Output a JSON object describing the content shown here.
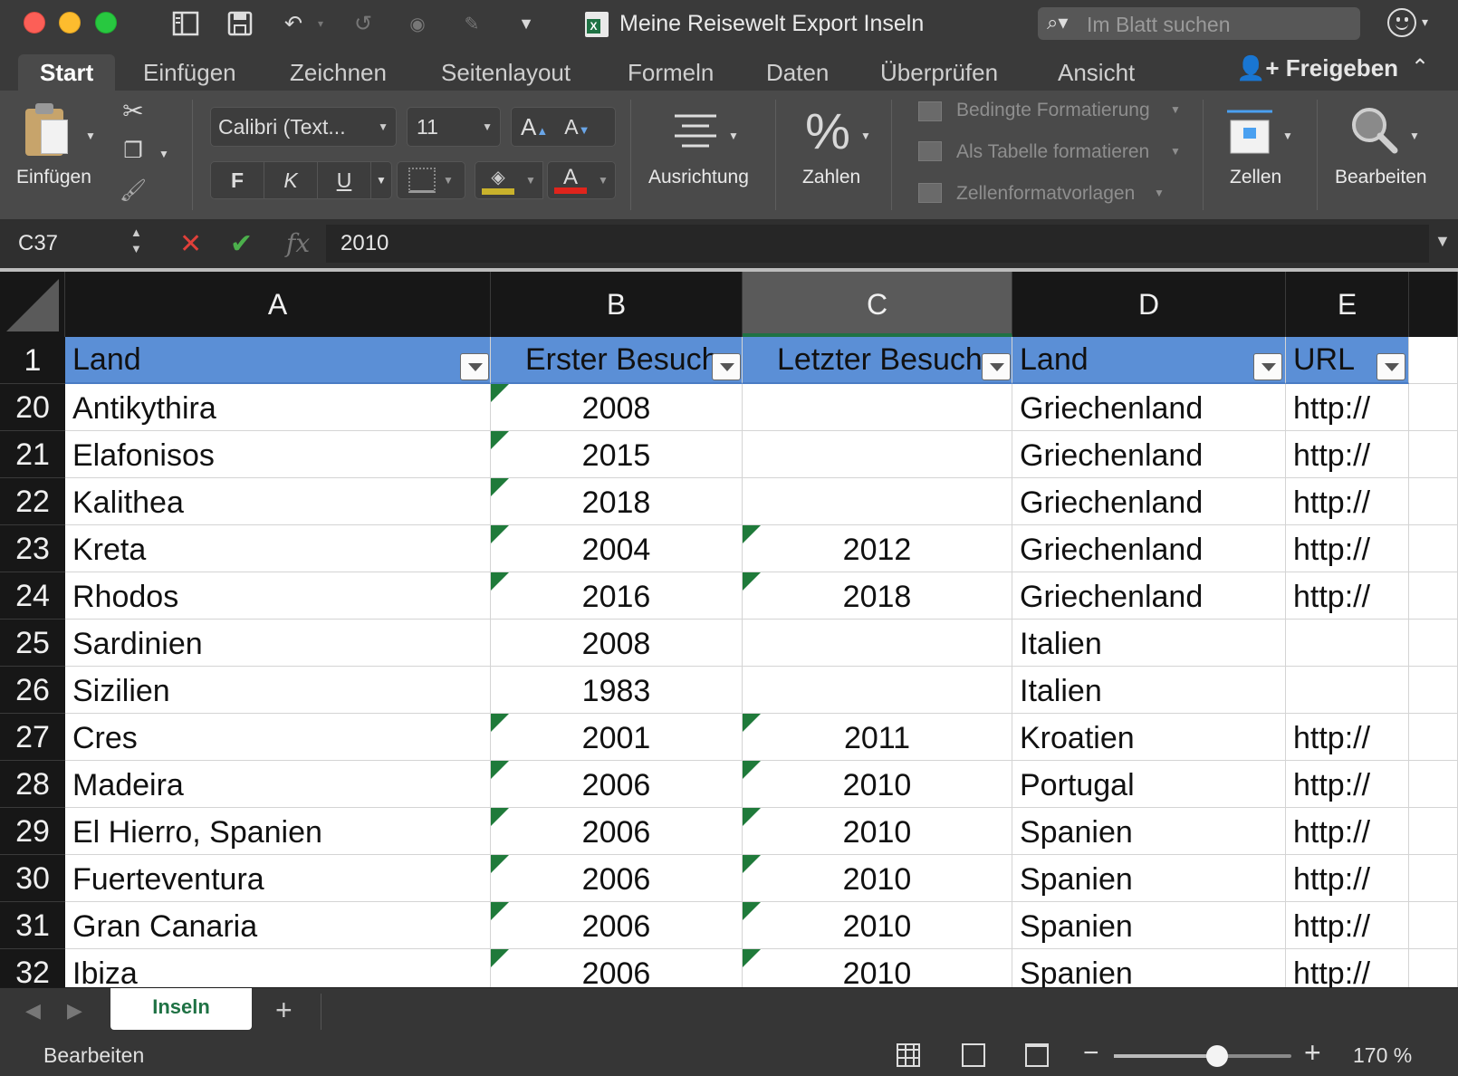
{
  "window": {
    "title": "Meine Reisewelt Export Inseln",
    "search_placeholder": "Im Blatt suchen"
  },
  "ribbon_tabs": [
    "Start",
    "Einfügen",
    "Zeichnen",
    "Seitenlayout",
    "Formeln",
    "Daten",
    "Überprüfen",
    "Ansicht"
  ],
  "share_label": "Freigeben",
  "ribbon": {
    "paste_label": "Einfügen",
    "font_name": "Calibri (Text...",
    "font_size": "11",
    "grow_font": "A",
    "shrink_font": "A",
    "bold": "F",
    "italic": "K",
    "underline": "U",
    "font_color_letter": "A",
    "alignment_label": "Ausrichtung",
    "number_label": "Zahlen",
    "number_symbol": "%",
    "conditional_formatting": "Bedingte Formatierung",
    "format_as_table": "Als Tabelle formatieren",
    "cell_styles": "Zellenformatvorlagen",
    "cells_label": "Zellen",
    "edit_label": "Bearbeiten",
    "fill_color": "#c9b22c",
    "font_color": "#e0241c"
  },
  "formula_bar": {
    "name_box": "C37",
    "fx": "fx",
    "value": "2010"
  },
  "columns": [
    "A",
    "B",
    "C",
    "D",
    "E"
  ],
  "selected_column": "C",
  "header_row": {
    "row": "1",
    "cells": [
      "Land",
      "Erster Besuch",
      "Letzter Besuch",
      "Land",
      "URL"
    ]
  },
  "rows": [
    {
      "row": "20",
      "a": "Antikythira",
      "b": "2008",
      "c": "",
      "d": "Griechenland",
      "e": "http://",
      "b_flag": true,
      "c_flag": false
    },
    {
      "row": "21",
      "a": "Elafonisos",
      "b": "2015",
      "c": "",
      "d": "Griechenland",
      "e": "http://",
      "b_flag": true,
      "c_flag": false
    },
    {
      "row": "22",
      "a": "Kalithea",
      "b": "2018",
      "c": "",
      "d": "Griechenland",
      "e": "http://",
      "b_flag": true,
      "c_flag": false
    },
    {
      "row": "23",
      "a": "Kreta",
      "b": "2004",
      "c": "2012",
      "d": "Griechenland",
      "e": "http://",
      "b_flag": true,
      "c_flag": true
    },
    {
      "row": "24",
      "a": "Rhodos",
      "b": "2016",
      "c": "2018",
      "d": "Griechenland",
      "e": "http://",
      "b_flag": true,
      "c_flag": true
    },
    {
      "row": "25",
      "a": "Sardinien",
      "b": "2008",
      "c": "",
      "d": "Italien",
      "e": "",
      "b_flag": false,
      "c_flag": false
    },
    {
      "row": "26",
      "a": "Sizilien",
      "b": "1983",
      "c": "",
      "d": "Italien",
      "e": "",
      "b_flag": false,
      "c_flag": false
    },
    {
      "row": "27",
      "a": "Cres",
      "b": "2001",
      "c": "2011",
      "d": "Kroatien",
      "e": "http://",
      "b_flag": true,
      "c_flag": true
    },
    {
      "row": "28",
      "a": "Madeira",
      "b": "2006",
      "c": "2010",
      "d": "Portugal",
      "e": "http://",
      "b_flag": true,
      "c_flag": true
    },
    {
      "row": "29",
      "a": "El Hierro, Spanien",
      "b": "2006",
      "c": "2010",
      "d": "Spanien",
      "e": "http://",
      "b_flag": true,
      "c_flag": true
    },
    {
      "row": "30",
      "a": "Fuerteventura",
      "b": "2006",
      "c": "2010",
      "d": "Spanien",
      "e": "http://",
      "b_flag": true,
      "c_flag": true
    },
    {
      "row": "31",
      "a": "Gran Canaria",
      "b": "2006",
      "c": "2010",
      "d": "Spanien",
      "e": "http://",
      "b_flag": true,
      "c_flag": true
    },
    {
      "row": "32",
      "a": "Ibiza",
      "b": "2006",
      "c": "2010",
      "d": "Spanien",
      "e": "http://",
      "b_flag": true,
      "c_flag": true
    }
  ],
  "sheet_tabs": [
    "Inseln"
  ],
  "status": {
    "mode": "Bearbeiten",
    "zoom": "170 %",
    "zoom_fraction": 0.58
  },
  "colors": {
    "header_fill": "#5b8fd6",
    "accent_green": "#1f7244",
    "error_flag": "#1f7a3a"
  }
}
